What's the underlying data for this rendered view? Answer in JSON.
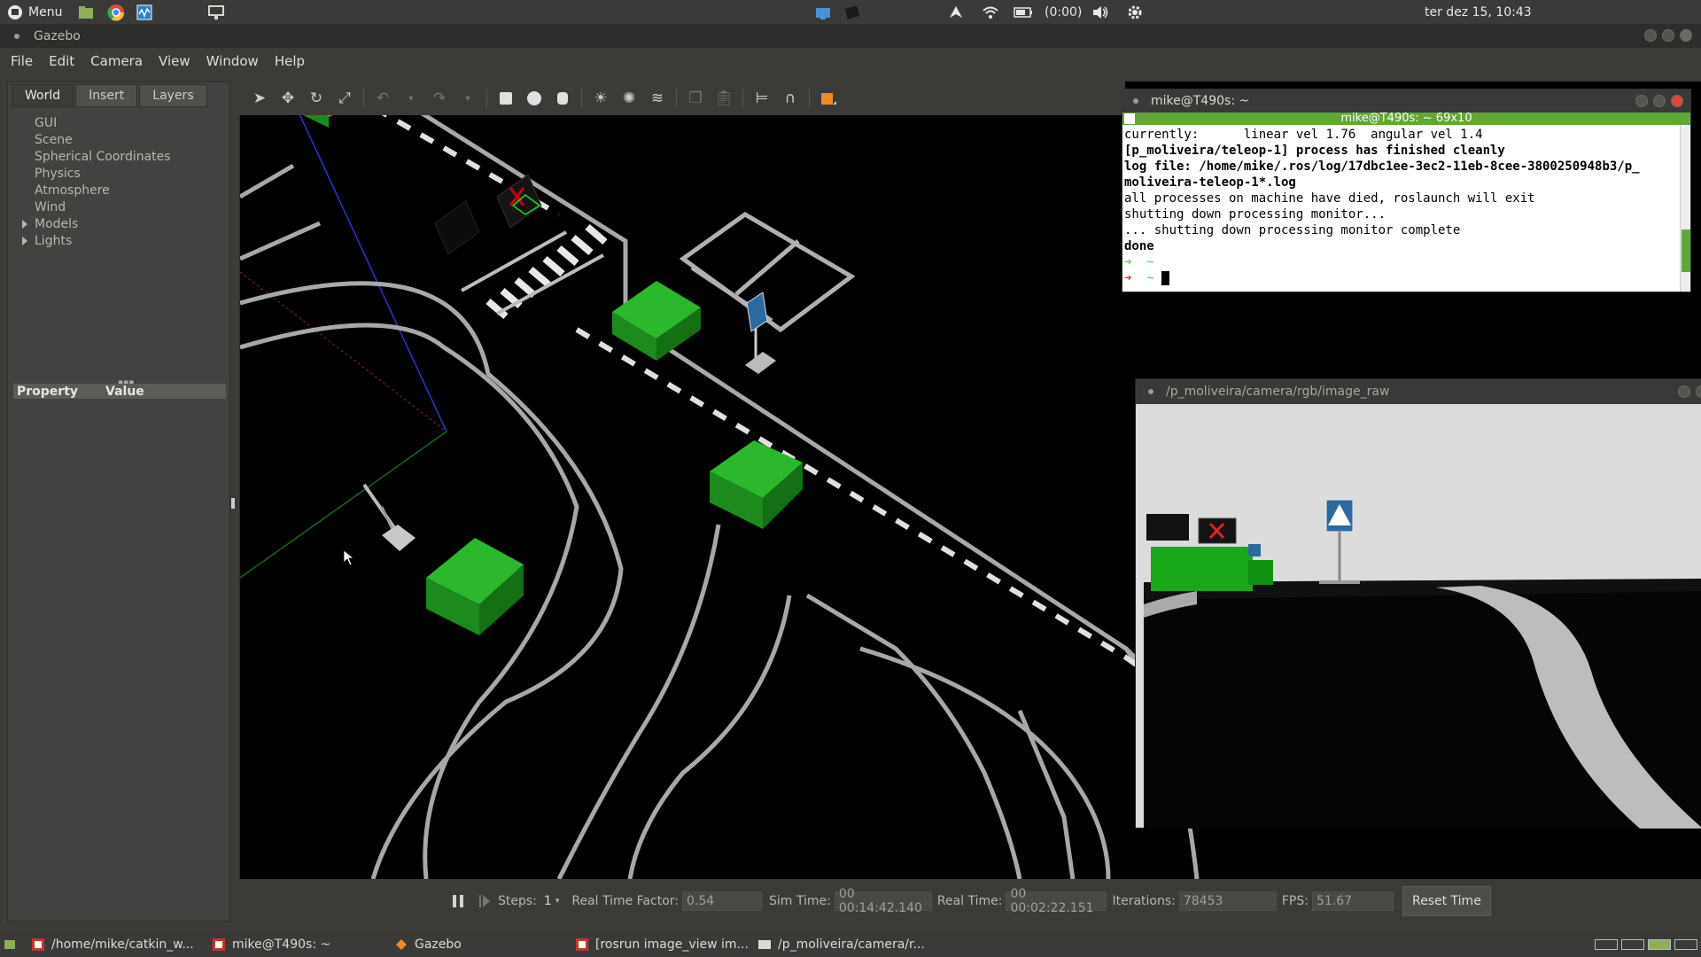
{
  "top_panel": {
    "menu_label": "Menu",
    "battery": "(0:00)",
    "datetime": "ter dez 15, 10:43"
  },
  "gazebo": {
    "window_title": "Gazebo",
    "menus": [
      "File",
      "Edit",
      "Camera",
      "View",
      "Window",
      "Help"
    ],
    "tabs": [
      "World",
      "Insert",
      "Layers"
    ],
    "world_tree": [
      "GUI",
      "Scene",
      "Spherical Coordinates",
      "Physics",
      "Atmosphere",
      "Wind",
      "Models",
      "Lights"
    ],
    "property_header": {
      "property": "Property",
      "value": "Value"
    },
    "status": {
      "steps_label": "Steps:",
      "steps_value": "1",
      "rtf_label": "Real Time Factor:",
      "rtf_value": "0.54",
      "sim_time_label": "Sim Time:",
      "sim_time_value": "00 00:14:42.140",
      "real_time_label": "Real Time:",
      "real_time_value": "00 00:02:22.151",
      "iterations_label": "Iterations:",
      "iterations_value": "78453",
      "fps_label": "FPS:",
      "fps_value": "51.67",
      "reset_label": "Reset Time"
    }
  },
  "terminal": {
    "window_title": "mike@T490s: ~",
    "subtitle": "mike@T490s: ~ 69x10",
    "lines": [
      "currently:      linear vel 1.76  angular vel 1.4",
      "[p_moliveira/teleop-1] process has finished cleanly",
      "log file: /home/mike/.ros/log/17dbc1ee-3ec2-11eb-8cee-3800250948b3/p_",
      "moliveira-teleop-1*.log",
      "all processes on machine have died, roslaunch will exit",
      "shutting down processing monitor...",
      "... shutting down processing monitor complete",
      "done"
    ],
    "prompt_symbol": "➜",
    "prompt_dir": "~"
  },
  "camera_window": {
    "title": "/p_moliveira/camera/rgb/image_raw"
  },
  "taskbar": {
    "items": [
      "/home/mike/catkin_w...",
      "mike@T490s: ~",
      "Gazebo",
      "[rosrun image_view im...",
      "/p_moliveira/camera/r..."
    ]
  },
  "colors": {
    "terminal_green_bar": "#5fa838",
    "model_green": "#1fa01f",
    "prompt_green": "#5fd35f",
    "prompt_red": "#e0302f"
  }
}
